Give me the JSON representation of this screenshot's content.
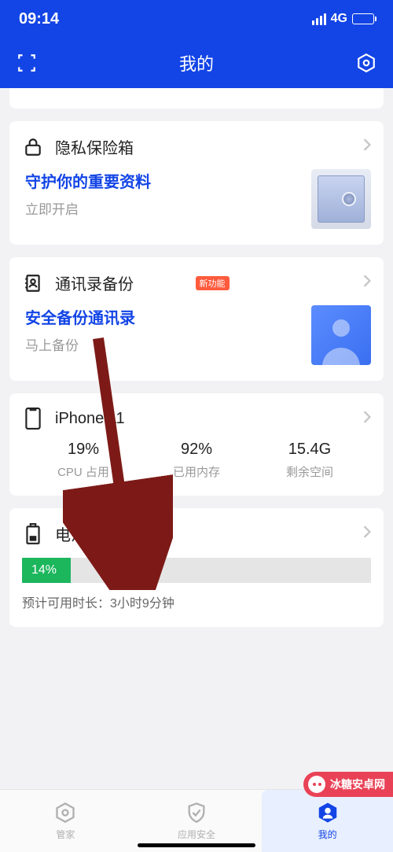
{
  "status": {
    "time": "09:14",
    "network": "4G"
  },
  "header": {
    "title": "我的"
  },
  "cards": {
    "privacy": {
      "title": "隐私保险箱",
      "link": "守护你的重要资料",
      "sub": "立即开启"
    },
    "contacts": {
      "title": "通讯录备份",
      "badge": "新功能",
      "link": "安全备份通讯录",
      "sub": "马上备份"
    },
    "device": {
      "title": "iPhone 11",
      "stats": [
        {
          "val": "19%",
          "lbl": "CPU 占用"
        },
        {
          "val": "92%",
          "lbl": "已用内存"
        },
        {
          "val": "15.4G",
          "lbl": "剩余空间"
        }
      ]
    },
    "battery": {
      "title": "电池管理",
      "percent": "14%",
      "percent_num": 14,
      "estimate_label": "预计可用时长：",
      "estimate_value": "3小时9分钟"
    }
  },
  "tabs": [
    {
      "label": "管家"
    },
    {
      "label": "应用安全"
    },
    {
      "label": "我的"
    }
  ],
  "watermark": "冰糖安卓网"
}
